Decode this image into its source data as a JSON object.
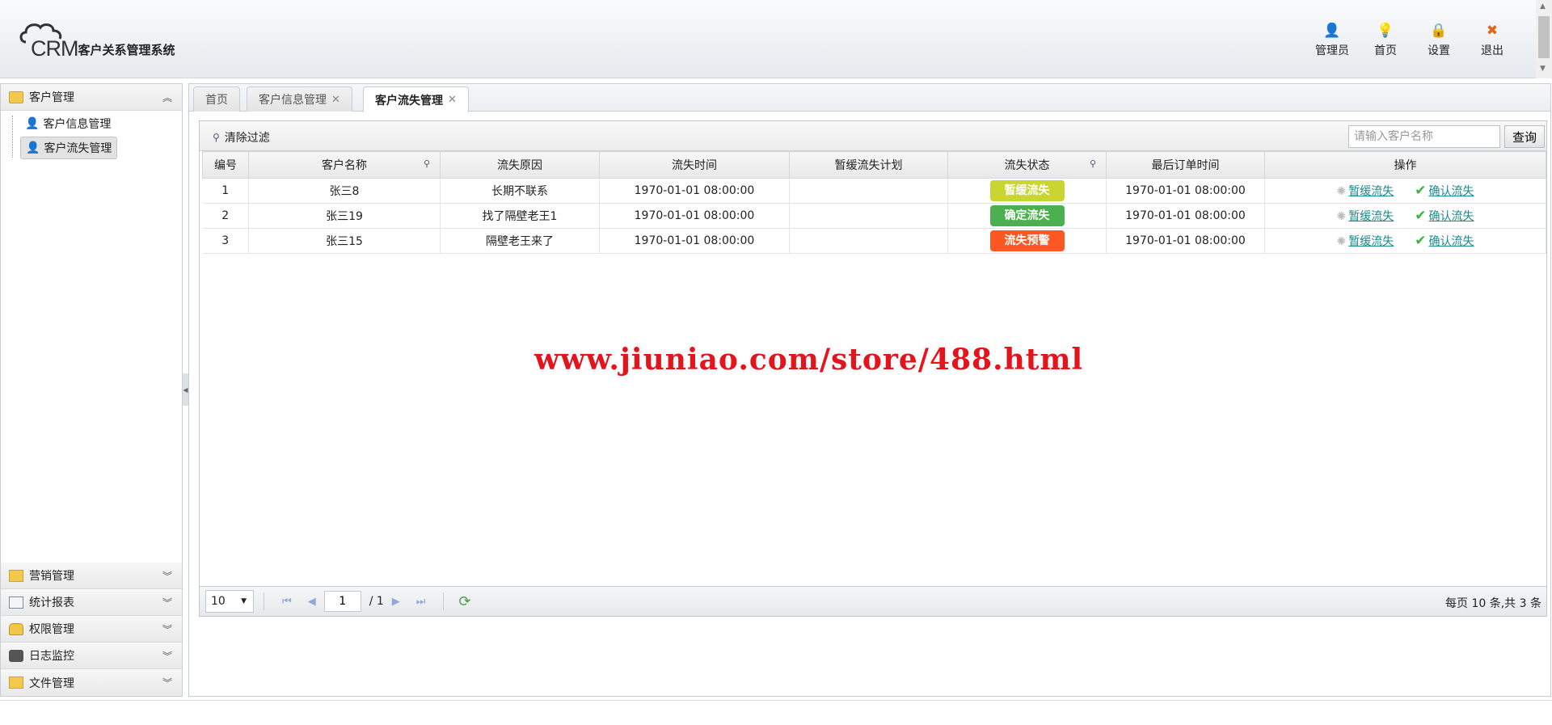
{
  "header": {
    "logo_text": "CRM",
    "system_name": "客户关系管理系统",
    "nav": [
      {
        "label": "管理员",
        "icon": "user-icon"
      },
      {
        "label": "首页",
        "icon": "lightbulb-icon"
      },
      {
        "label": "设置",
        "icon": "lock-icon"
      },
      {
        "label": "退出",
        "icon": "close-icon"
      }
    ]
  },
  "sidebar": {
    "open_section": {
      "label": "客户管理",
      "items": [
        {
          "label": "客户信息管理"
        },
        {
          "label": "客户流失管理"
        }
      ]
    },
    "sections": [
      {
        "label": "营销管理"
      },
      {
        "label": "统计报表"
      },
      {
        "label": "权限管理"
      },
      {
        "label": "日志监控"
      },
      {
        "label": "文件管理"
      }
    ]
  },
  "tabs": [
    {
      "label": "首页"
    },
    {
      "label": "客户信息管理",
      "close": "✕"
    },
    {
      "label": "客户流失管理",
      "close": "✕"
    }
  ],
  "toolbar": {
    "clear_filter": "清除过滤",
    "search_placeholder": "请输入客户名称",
    "search_value": "",
    "query_button": "查询"
  },
  "table": {
    "columns": [
      "编号",
      "客户名称",
      "流失原因",
      "流失时间",
      "暂缓流失计划",
      "流失状态",
      "最后订单时间",
      "操作"
    ],
    "rows": [
      {
        "id": "1",
        "name": "张三8",
        "reason": "长期不联系",
        "lost_time": "1970-01-01 08:00:00",
        "plan": "",
        "status": "暂缓流失",
        "status_color": "#c9d631",
        "last_order": "1970-01-01 08:00:00"
      },
      {
        "id": "2",
        "name": "张三19",
        "reason": "找了隔壁老王1",
        "lost_time": "1970-01-01 08:00:00",
        "plan": "",
        "status": "确定流失",
        "status_color": "#4caf50",
        "last_order": "1970-01-01 08:00:00"
      },
      {
        "id": "3",
        "name": "张三15",
        "reason": "隔壁老王来了",
        "lost_time": "1970-01-01 08:00:00",
        "plan": "",
        "status": "流失预警",
        "status_color": "#ff5722",
        "last_order": "1970-01-01 08:00:00"
      }
    ],
    "actions": {
      "defer": "暂缓流失",
      "confirm": "确认流失"
    }
  },
  "pager": {
    "page_size": "10",
    "page": "1",
    "total_pages": "/ 1",
    "info": "每页 10 条,共 3 条"
  },
  "watermark": "www.jiuniao.com/store/488.html"
}
